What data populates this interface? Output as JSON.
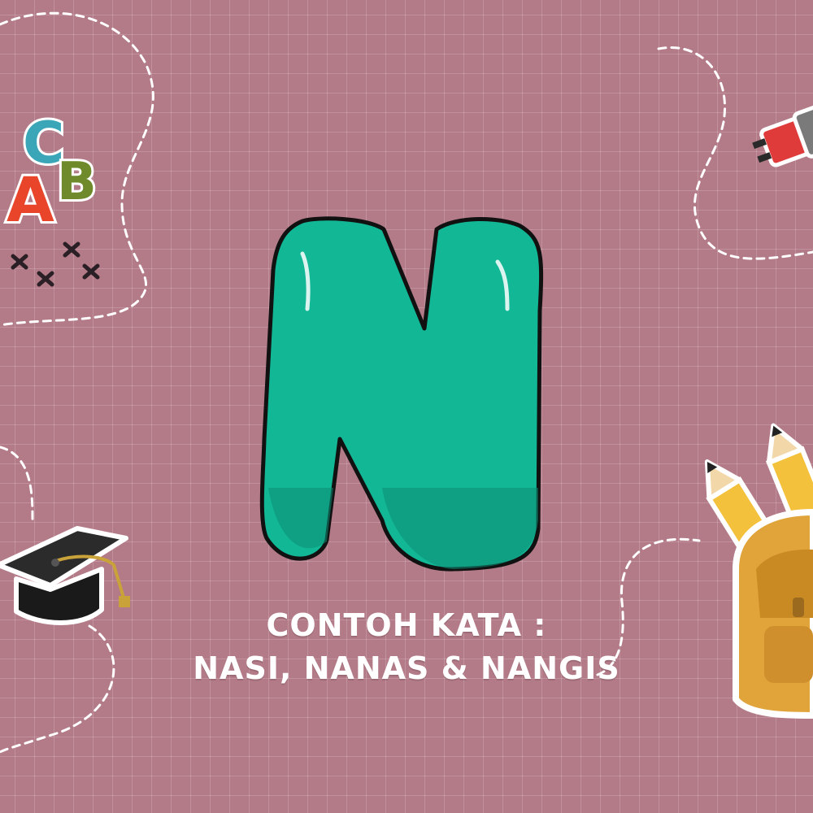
{
  "letter": {
    "glyph": "N",
    "color": "#12b795"
  },
  "caption": {
    "line1": "CONTOH KATA :",
    "line2": "NASI, NANAS & NANGIS"
  },
  "background": {
    "color": "#b37a87",
    "grid": true
  },
  "decorations": {
    "abc_blocks": [
      "C",
      "A",
      "B"
    ],
    "icons": [
      "abc-blocks-icon",
      "sparkle-cross-icon",
      "marker-pen-icon",
      "graduation-cap-icon",
      "pencil-icon",
      "backpack-icon"
    ]
  }
}
